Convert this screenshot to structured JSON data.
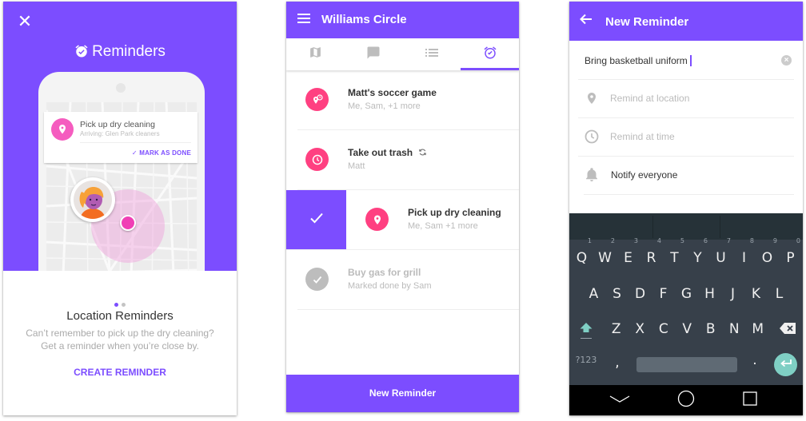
{
  "colors": {
    "accent": "#7c4dff",
    "pink": "#ff4081",
    "map_pin": "#f55cbf",
    "keyboard_bg": "#37404a",
    "enter_key": "#7fcfc4"
  },
  "onboarding": {
    "close_icon": "close-icon",
    "title": "Reminders",
    "notification": {
      "title": "Pick up dry cleaning",
      "subtitle": "Arriving: Glen Park cleaners",
      "action": "MARK AS DONE",
      "action_glyph": "✓"
    },
    "pager": {
      "total": 2,
      "active": 1
    },
    "heading": "Location Reminders",
    "description_line1": "Can’t remember to pick up the dry cleaning?",
    "description_line2": "Get a reminder when you’re close by.",
    "cta": "CREATE REMINDER"
  },
  "list_screen": {
    "title": "Williams Circle",
    "tabs": [
      {
        "name": "map",
        "icon": "map-icon",
        "active": false
      },
      {
        "name": "chat",
        "icon": "chat-icon",
        "active": false
      },
      {
        "name": "list",
        "icon": "list-icon",
        "active": false
      },
      {
        "name": "reminders",
        "icon": "alarm-icon",
        "active": true
      }
    ],
    "reminders": [
      {
        "title": "Matt's soccer game",
        "subtitle": "Me, Sam, +1 more",
        "icon": "location-time-icon",
        "state": "active"
      },
      {
        "title": "Take out trash",
        "subtitle": "Matt",
        "icon": "clock-icon",
        "repeat": true,
        "state": "active"
      },
      {
        "title": "Pick up dry cleaning",
        "subtitle": "Me, Sam +1 more",
        "icon": "location-pin-icon",
        "state": "swiped"
      },
      {
        "title": "Buy gas for grill",
        "subtitle": "Marked done by Sam",
        "icon": "check-icon",
        "state": "done"
      }
    ],
    "new_button": "New Reminder"
  },
  "new_reminder": {
    "title": "New Reminder",
    "input_value": "Bring basketball uniform",
    "fields": [
      {
        "label": "Remind at location",
        "icon": "location-pin-icon",
        "placeholder": true
      },
      {
        "label": "Remind at time",
        "icon": "clock-icon",
        "placeholder": true
      },
      {
        "label": "Notify everyone",
        "icon": "bell-icon",
        "placeholder": false
      }
    ],
    "keyboard": {
      "row1": [
        "Q",
        "W",
        "E",
        "R",
        "T",
        "Y",
        "U",
        "I",
        "O",
        "P"
      ],
      "row1_hints": [
        "1",
        "2",
        "3",
        "4",
        "5",
        "6",
        "7",
        "8",
        "9",
        "0"
      ],
      "row2": [
        "A",
        "S",
        "D",
        "F",
        "G",
        "H",
        "J",
        "K",
        "L"
      ],
      "row3": [
        "Z",
        "X",
        "C",
        "V",
        "B",
        "N",
        "M"
      ],
      "symbols_key": "?123",
      "comma": ",",
      "period": "."
    }
  }
}
